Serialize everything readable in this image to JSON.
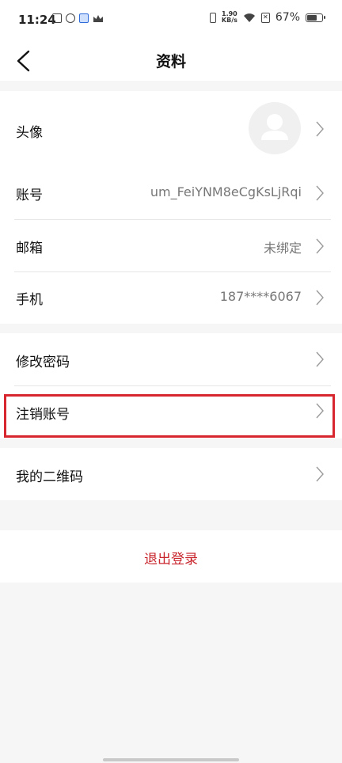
{
  "status_bar": {
    "time": "11:24",
    "net_speed_value": "1.90",
    "net_speed_unit": "KB/s",
    "battery": "67%"
  },
  "header": {
    "title": "资料",
    "back_icon": "chevron-left-icon"
  },
  "profile_rows": [
    {
      "label": "头像",
      "value": ""
    },
    {
      "label": "账号",
      "value": "um_FeiYNM8eCgKsLjRqi"
    },
    {
      "label": "邮箱",
      "value": "未绑定"
    },
    {
      "label": "手机",
      "value": "187****6067"
    }
  ],
  "security_rows": [
    {
      "label": "修改密码"
    },
    {
      "label": "注销账号"
    }
  ],
  "qr_row": {
    "label": "我的二维码"
  },
  "logout": {
    "label": "退出登录"
  },
  "colors": {
    "accent_red": "#c8252c",
    "highlight_red": "#d8262e"
  }
}
